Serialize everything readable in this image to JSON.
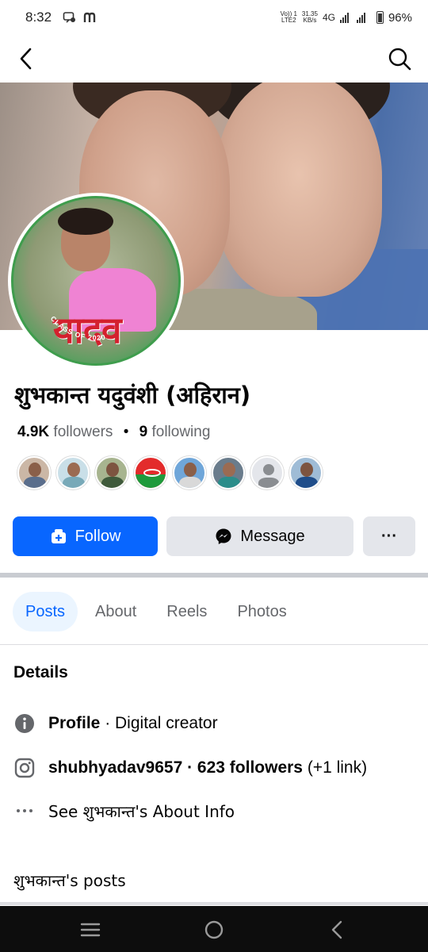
{
  "status_bar": {
    "time": "8:32",
    "network_top": "Vo)) 1",
    "network_bottom": "LTE2",
    "speed_top": "31.35",
    "speed_bottom": "KB/s",
    "network_type": "4G",
    "battery": "96%"
  },
  "profile": {
    "name": "शुभकान्त यदुवंशी (अहिरान)",
    "avatar_text": "यादव",
    "avatar_ring_text": "CLASS OF 2020",
    "followers_count": "4.9K",
    "followers_label": "followers",
    "following_count": "9",
    "following_label": "following"
  },
  "actions": {
    "follow_label": "Follow",
    "message_label": "Message",
    "more_label": "···"
  },
  "tabs": [
    {
      "label": "Posts",
      "active": true
    },
    {
      "label": "About",
      "active": false
    },
    {
      "label": "Reels",
      "active": false
    },
    {
      "label": "Photos",
      "active": false
    }
  ],
  "details": {
    "title": "Details",
    "profile_label": "Profile",
    "profile_value": " · Digital creator",
    "insta_handle": "shubhyadav9657",
    "insta_followers": " · 623 followers",
    "insta_extra": " (+1 link)",
    "about_text": "See शुभकान्त's About Info"
  },
  "posts_title": "शुभकान्त's posts",
  "colors": {
    "accent": "#0866ff",
    "button_gray": "#e4e6eb",
    "tab_active_bg": "#ebf5ff",
    "secondary_text": "#65676b"
  }
}
